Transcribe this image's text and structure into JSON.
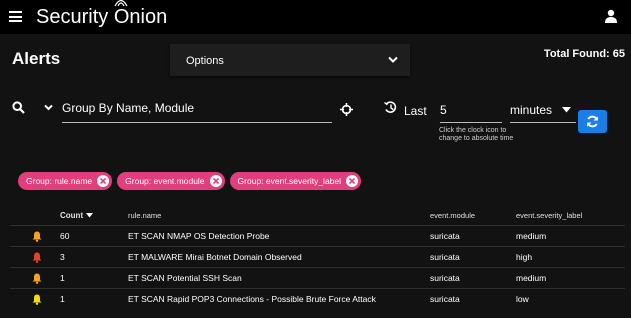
{
  "app": {
    "brand": "Security Onion"
  },
  "page": {
    "title": "Alerts",
    "options_label": "Options",
    "total_found": "Total Found: 65"
  },
  "search": {
    "query": "Group By Name, Module",
    "last_label": "Last",
    "last_value": "5",
    "unit": "minutes",
    "hint": "Click the clock icon to change to absolute time"
  },
  "chips": [
    "Group: rule.name",
    "Group: event.module",
    "Group: event.severity_label"
  ],
  "table": {
    "headers": {
      "count": "Count",
      "rule": "rule.name",
      "module": "event.module",
      "severity": "event.severity_label"
    },
    "rows": [
      {
        "count": "60",
        "rule": "ET SCAN NMAP OS Detection Probe",
        "module": "suricata",
        "severity": "medium",
        "bell_color": "#f7a21b"
      },
      {
        "count": "3",
        "rule": "ET MALWARE Mirai Botnet Domain Observed",
        "module": "suricata",
        "severity": "high",
        "bell_color": "#e5431f"
      },
      {
        "count": "1",
        "rule": "ET SCAN Potential SSH Scan",
        "module": "suricata",
        "severity": "medium",
        "bell_color": "#f7a21b"
      },
      {
        "count": "1",
        "rule": "ET SCAN Rapid POP3 Connections - Possible Brute Force Attack",
        "module": "suricata",
        "severity": "low",
        "bell_color": "#f5d90a"
      }
    ]
  },
  "colors": {
    "accent": "#1a7ee6",
    "chip": "#e23d7d"
  }
}
